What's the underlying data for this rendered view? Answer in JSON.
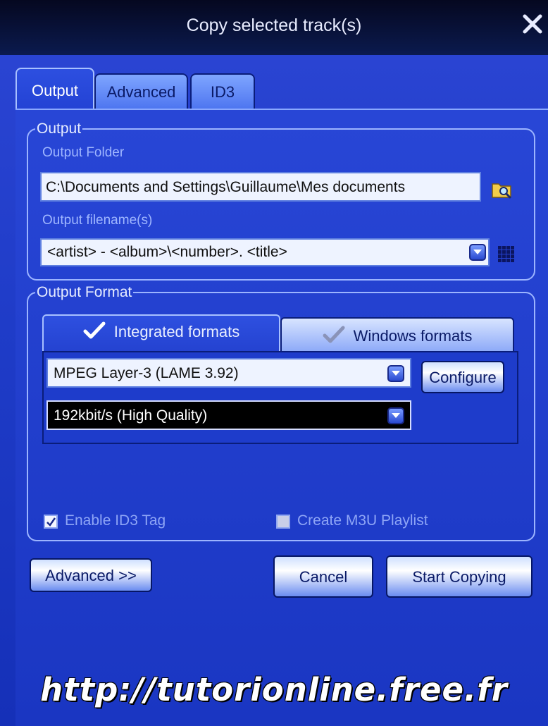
{
  "window": {
    "title": "Copy selected track(s)",
    "close_icon": "close-x-icon"
  },
  "tabs": [
    {
      "label": "Output",
      "active": true
    },
    {
      "label": "Advanced",
      "active": false
    },
    {
      "label": "ID3",
      "active": false
    }
  ],
  "output_group": {
    "legend": "Output",
    "folder_label": "Output Folder",
    "folder_value": "C:\\Documents and Settings\\Guillaume\\Mes documents",
    "browse_icon": "folder-search-icon",
    "filename_label": "Output filename(s)",
    "filename_value": "<artist> - <album>\\<number>. <title>",
    "pattern_icon": "pattern-grid-icon"
  },
  "format_group": {
    "legend": "Output Format",
    "tabs": [
      {
        "label": "Integrated formats",
        "active": true
      },
      {
        "label": "Windows formats",
        "active": false
      }
    ],
    "encoder_value": "MPEG Layer-3 (LAME 3.92)",
    "configure_label": "Configure",
    "bitrate_value": "192kbit/s (High Quality)",
    "enable_id3_label": "Enable ID3 Tag",
    "enable_id3_checked": true,
    "create_m3u_label": "Create M3U Playlist",
    "create_m3u_checked": false
  },
  "buttons": {
    "advanced": "Advanced >>",
    "cancel": "Cancel",
    "start": "Start Copying"
  },
  "watermark": "http://tutorionline.free.fr",
  "colors": {
    "accent": "#1a35c4",
    "title_bar": "#0b1a4e"
  }
}
